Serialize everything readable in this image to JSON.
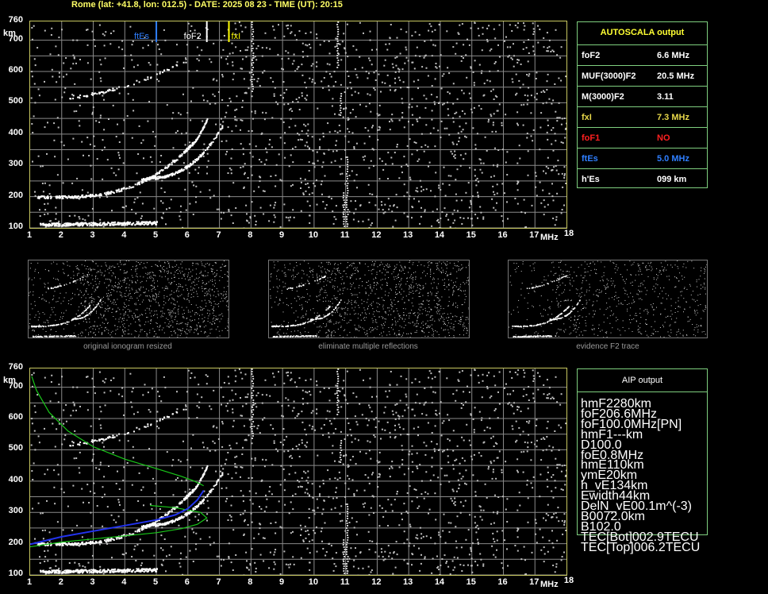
{
  "header": {
    "title": "Rome (lat: +41.8, lon: 012.5) - DATE: 2025 08 23 - TIME (UT): 20:15"
  },
  "axes": {
    "y_unit": "km",
    "x_unit": "MHz",
    "y_ticks": [
      "760",
      "700",
      "600",
      "500",
      "400",
      "300",
      "200",
      "100"
    ],
    "x_ticks": [
      "1",
      "2",
      "3",
      "4",
      "5",
      "6",
      "7",
      "8",
      "9",
      "10",
      "11",
      "12",
      "13",
      "14",
      "15",
      "16",
      "17",
      "18"
    ]
  },
  "markers": {
    "ftes": "ftEs",
    "fof2": "foF2",
    "fxi": "fxI"
  },
  "autoscala": {
    "title": "AUTOSCALA output",
    "rows": [
      {
        "label": "foF2",
        "value": "6.6 MHz",
        "color": "#ffffff"
      },
      {
        "label": "MUF(3000)F2",
        "value": "20.5 MHz",
        "color": "#ffffff"
      },
      {
        "label": "M(3000)F2",
        "value": "3.11",
        "color": "#ffffff"
      },
      {
        "label": "fxI",
        "value": "7.3 MHz",
        "color": "#e8d84a"
      },
      {
        "label": "foF1",
        "value": "NO",
        "color": "#ff2020"
      },
      {
        "label": "ftEs",
        "value": "5.0 MHz",
        "color": "#2f7fff"
      },
      {
        "label": "h'Es",
        "value": "099    km",
        "color": "#ffffff"
      }
    ]
  },
  "thumbnails": [
    {
      "caption": "original ionogram resized"
    },
    {
      "caption": "eliminate multiple reflections"
    },
    {
      "caption": "evidence F2 trace"
    }
  ],
  "aip": {
    "title": "AIP output",
    "rows": [
      {
        "name": "hmF2",
        "value": "280",
        "unit": "km",
        "extra": ""
      },
      {
        "name": "foF2",
        "value": "06.6",
        "unit": "MHz",
        "extra": ""
      },
      {
        "name": "foF1",
        "value": "00.0",
        "unit": "MHz",
        "extra": "[PN]"
      },
      {
        "name": "hmF1",
        "value": "---",
        "unit": "km",
        "extra": ""
      },
      {
        "name": "D1",
        "value": "00.0",
        "unit": "",
        "extra": ""
      },
      {
        "name": "foE",
        "value": "0.8",
        "unit": "MHz",
        "extra": ""
      },
      {
        "name": "hmE",
        "value": "110",
        "unit": "km",
        "extra": ""
      },
      {
        "name": "ymE",
        "value": "20",
        "unit": "km",
        "extra": ""
      },
      {
        "name": "h_vE",
        "value": "134",
        "unit": "km",
        "extra": ""
      },
      {
        "name": "Ewidth",
        "value": "44",
        "unit": "km",
        "extra": ""
      },
      {
        "name": "DelN_vE",
        "value": "00.1",
        "unit": "m^(-3)",
        "extra": ""
      },
      {
        "name": "B0",
        "value": "072.0",
        "unit": "km",
        "extra": ""
      },
      {
        "name": "B1",
        "value": "02.0",
        "unit": "",
        "extra": ""
      },
      {
        "name": "TEC[Bot]",
        "value": "002.9",
        "unit": "TECU",
        "extra": ""
      },
      {
        "name": "TEC[Top]",
        "value": "006.2",
        "unit": "TECU",
        "extra": ""
      }
    ]
  },
  "colors": {
    "frame": "#c8c860",
    "grid": "#8a8a8a",
    "panel": "#7fcf7f",
    "ftes": "#2f7fff",
    "fxi": "#ffff00",
    "fof2": "#ffffff",
    "profile_green": "#19c819",
    "profile_blue": "#2233ee"
  }
}
